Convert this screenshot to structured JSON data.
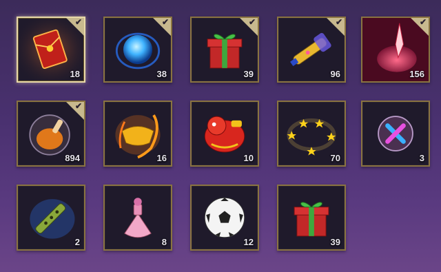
{
  "inventory": {
    "items": [
      {
        "name": "red-envelope",
        "count": "18",
        "owned": true,
        "selected": true
      },
      {
        "name": "blue-orb",
        "count": "38",
        "owned": true
      },
      {
        "name": "gift-box",
        "count": "39",
        "owned": true
      },
      {
        "name": "water-gun",
        "count": "96",
        "owned": true
      },
      {
        "name": "red-heart-blade",
        "count": "156",
        "owned": true
      },
      {
        "name": "roast-chicken-bubble",
        "count": "894",
        "owned": true
      },
      {
        "name": "gold-ingot-fish",
        "count": "16",
        "owned": true
      },
      {
        "name": "red-lion-figure",
        "count": "10",
        "owned": false
      },
      {
        "name": "star-ring",
        "count": "70",
        "owned": false
      },
      {
        "name": "cross-bubble",
        "count": "3",
        "owned": false
      },
      {
        "name": "green-flute",
        "count": "2",
        "owned": false
      },
      {
        "name": "pink-perfume-bottle",
        "count": "8",
        "owned": false
      },
      {
        "name": "soccer-ball",
        "count": "12",
        "owned": false
      },
      {
        "name": "gift-box",
        "count": "39",
        "owned": false
      }
    ],
    "check_glyph": "✔"
  }
}
